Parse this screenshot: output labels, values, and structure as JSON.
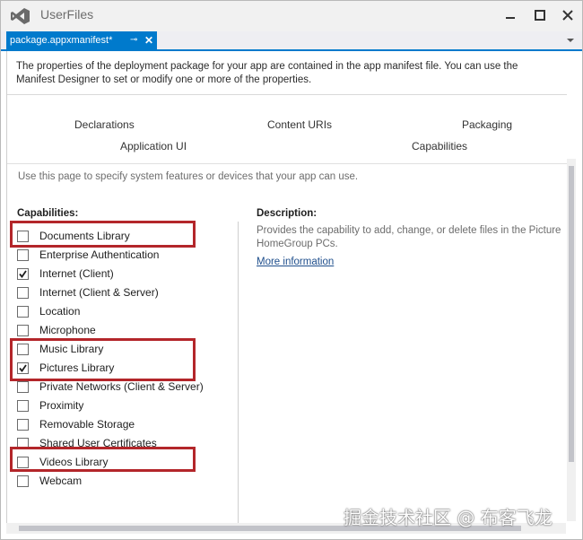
{
  "app": {
    "title": "UserFiles"
  },
  "editor_tab": {
    "label": "package.appxmanifest*",
    "pin_icon": "pin-icon",
    "close_icon": "close-icon"
  },
  "intro": "The properties of the deployment package for your app are contained in the app manifest file. You can use the Manifest Designer to set or modify one or more of the properties.",
  "nav_tabs": [
    "Declarations",
    "Content URIs",
    "Packaging",
    "Application UI",
    "Capabilities"
  ],
  "hint": "Use this page to specify system features or devices that your app can use.",
  "capabilities": {
    "title": "Capabilities:",
    "items": [
      {
        "label": "Documents Library",
        "checked": false
      },
      {
        "label": "Enterprise Authentication",
        "checked": false
      },
      {
        "label": "Internet (Client)",
        "checked": true
      },
      {
        "label": "Internet (Client & Server)",
        "checked": false
      },
      {
        "label": "Location",
        "checked": false
      },
      {
        "label": "Microphone",
        "checked": false
      },
      {
        "label": "Music Library",
        "checked": false
      },
      {
        "label": "Pictures Library",
        "checked": true
      },
      {
        "label": "Private Networks (Client & Server)",
        "checked": false
      },
      {
        "label": "Proximity",
        "checked": false
      },
      {
        "label": "Removable Storage",
        "checked": false
      },
      {
        "label": "Shared User Certificates",
        "checked": false
      },
      {
        "label": "Videos Library",
        "checked": false
      },
      {
        "label": "Webcam",
        "checked": false
      }
    ]
  },
  "description": {
    "title": "Description:",
    "text_line1": "Provides the capability to add, change, or delete files in the Picture",
    "text_line2": "HomeGroup PCs.",
    "more_link": "More information"
  },
  "watermark": "掘金技术社区 @ 布客飞龙",
  "colors": {
    "accent": "#007acc",
    "highlight": "#b3262a",
    "link": "#1e4e8c"
  }
}
